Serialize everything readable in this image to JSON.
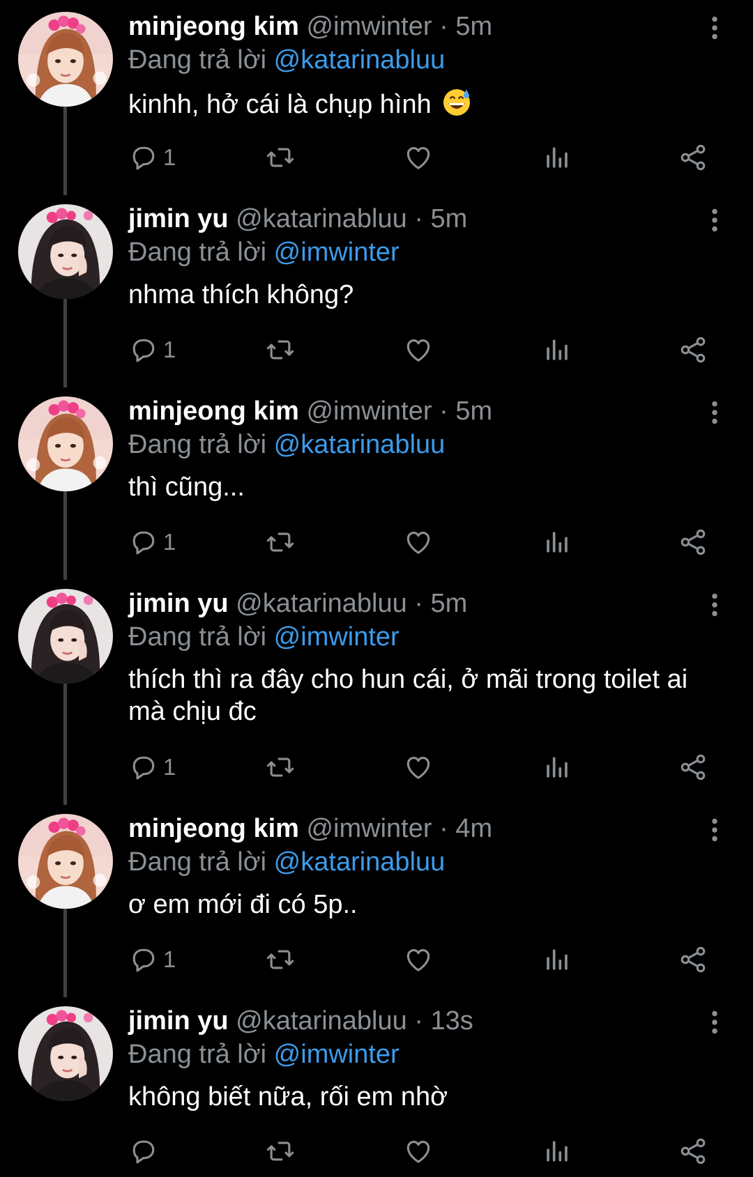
{
  "colors": {
    "background": "#000000",
    "name": "#ffffff",
    "meta": "#8b9095",
    "mention": "#3c9bea",
    "icon": "#8b9095",
    "thread_line": "#3e4144"
  },
  "reply_prefix": "Đang trả lời",
  "icons": {
    "reply": "reply-bubble-icon",
    "retweet": "retweet-icon",
    "like": "heart-icon",
    "views": "bar-chart-icon",
    "share": "share-icon",
    "more": "vertical-ellipsis-icon"
  },
  "tweets": [
    {
      "name": "minjeong kim",
      "handle": "@imwinter",
      "time": "5m",
      "reply_to": "@katarinabluu",
      "text": "kinhh, hở cái là chụp hình",
      "emoji": "grinning-face-with-sweat",
      "reply_count": "1",
      "avatar": "minjeong-avatar"
    },
    {
      "name": "jimin yu",
      "handle": "@katarinabluu",
      "time": "5m",
      "reply_to": "@imwinter",
      "text": "nhma thích không?",
      "reply_count": "1",
      "avatar": "jimin-avatar"
    },
    {
      "name": "minjeong kim",
      "handle": "@imwinter",
      "time": "5m",
      "reply_to": "@katarinabluu",
      "text": "thì cũng...",
      "reply_count": "1",
      "avatar": "minjeong-avatar"
    },
    {
      "name": "jimin yu",
      "handle": "@katarinabluu",
      "time": "5m",
      "reply_to": "@imwinter",
      "text_line1": "thích thì ra đây cho hun cái, ở mãi trong toilet ai",
      "text_line2": "mà chịu đc",
      "reply_count": "1",
      "avatar": "jimin-avatar"
    },
    {
      "name": "minjeong kim",
      "handle": "@imwinter",
      "time": "4m",
      "reply_to": "@katarinabluu",
      "text": "ơ em mới đi có 5p..",
      "reply_count": "1",
      "avatar": "minjeong-avatar"
    },
    {
      "name": "jimin yu",
      "handle": "@katarinabluu",
      "time": "13s",
      "reply_to": "@imwinter",
      "text": "không biết nữa, rối em nhờ",
      "reply_count": "",
      "avatar": "jimin-avatar"
    }
  ]
}
